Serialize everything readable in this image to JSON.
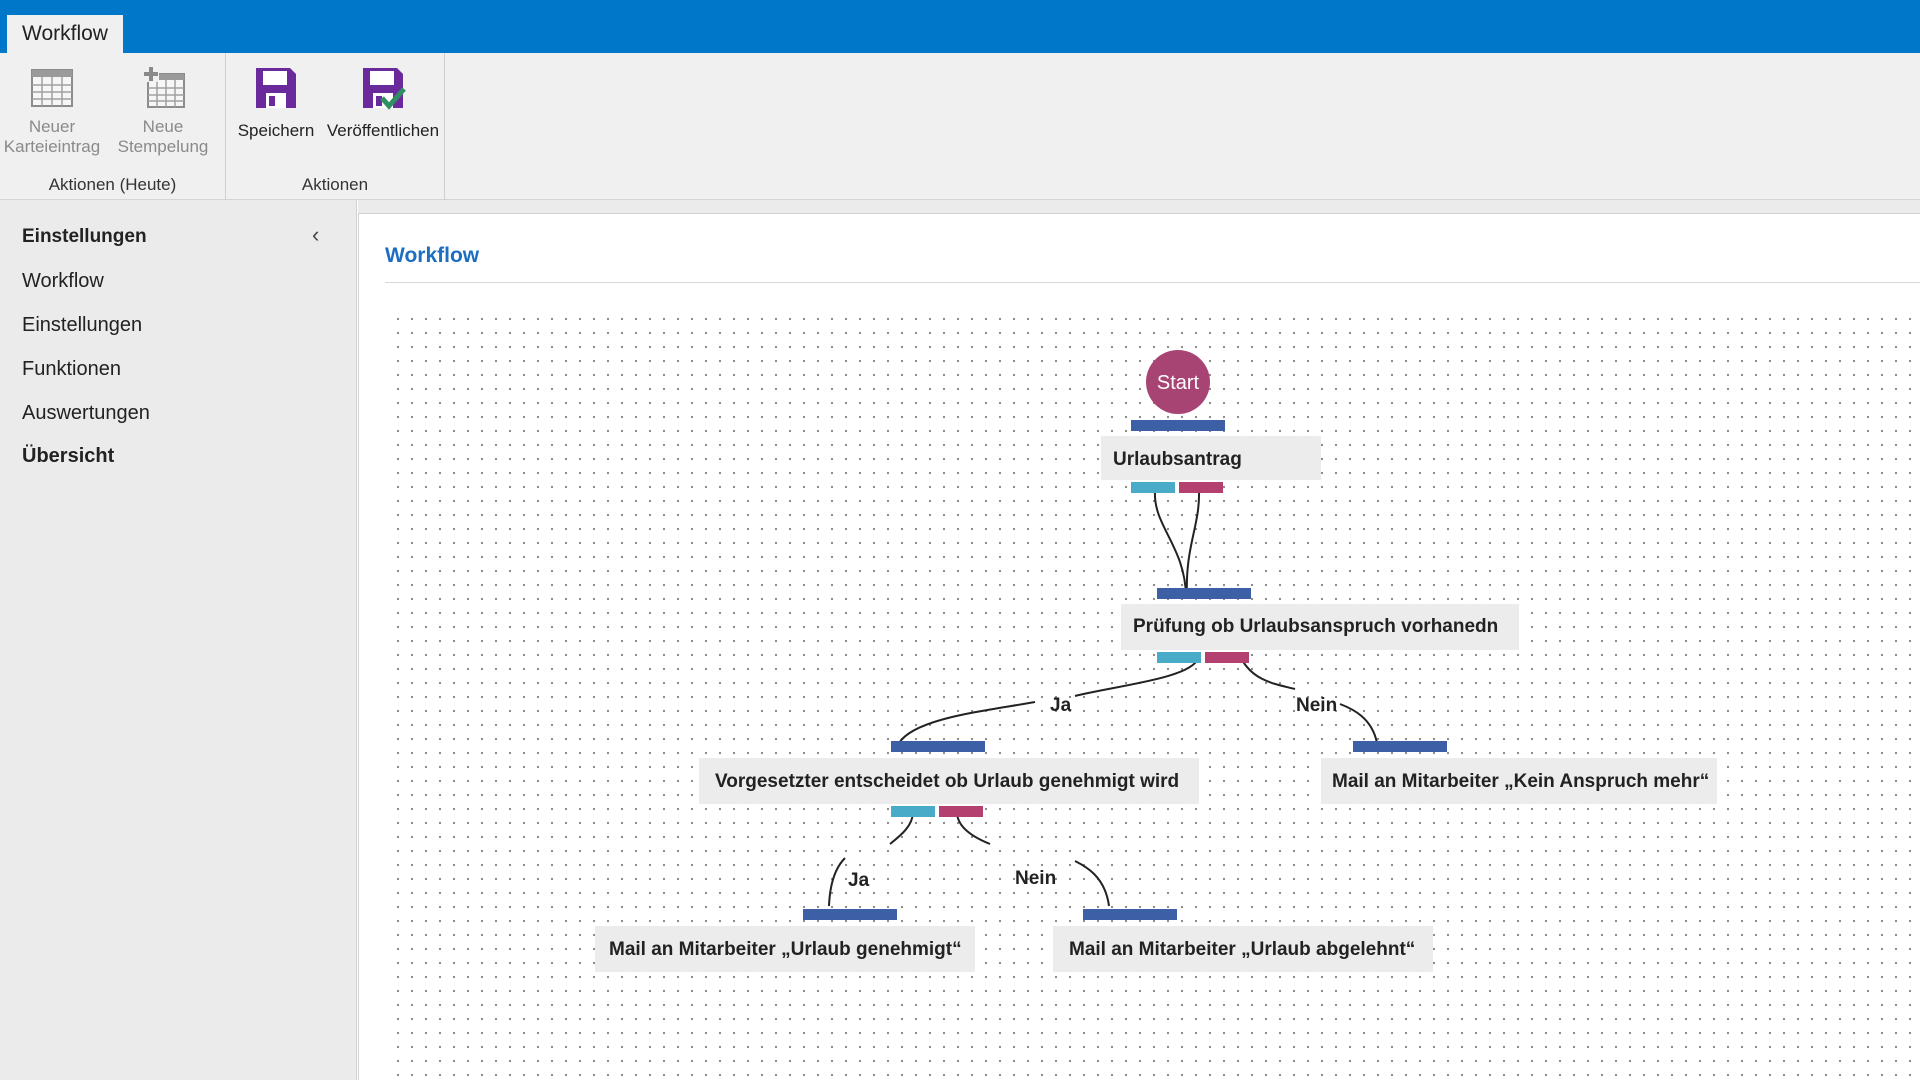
{
  "header": {
    "tab_label": "Workflow"
  },
  "ribbon": {
    "groups": [
      {
        "label": "Aktionen (Heute)",
        "buttons": [
          {
            "label_line1": "Neuer",
            "label_line2": "Karteieintrag",
            "enabled": false,
            "icon": "calendar-icon"
          },
          {
            "label_line1": "Neue",
            "label_line2": "Stempelung",
            "enabled": false,
            "icon": "calendar-add-icon"
          }
        ]
      },
      {
        "label": "Aktionen",
        "buttons": [
          {
            "label": "Speichern",
            "enabled": true,
            "icon": "save-icon"
          },
          {
            "label": "Veröffentlichen",
            "enabled": true,
            "icon": "save-publish-icon"
          }
        ]
      }
    ]
  },
  "sidebar": {
    "header": "Einstellungen",
    "items": [
      {
        "label": "Workflow",
        "bold": false
      },
      {
        "label": "Einstellungen",
        "bold": false
      },
      {
        "label": "Funktionen",
        "bold": false
      },
      {
        "label": "Auswertungen",
        "bold": false
      },
      {
        "label": "Übersicht",
        "bold": true
      }
    ]
  },
  "main": {
    "title": "Workflow"
  },
  "workflow": {
    "start_label": "Start",
    "nodes": [
      {
        "id": "urlaubsantrag",
        "label": "Urlaubsantrag"
      },
      {
        "id": "pruefung",
        "label": "Prüfung ob Urlaubsanspruch vorhanedn"
      },
      {
        "id": "vorgesetzter",
        "label": "Vorgesetzter entscheidet ob Urlaub genehmigt wird"
      },
      {
        "id": "kein-anspruch",
        "label": "Mail an Mitarbeiter „Kein Anspruch mehr“"
      },
      {
        "id": "genehmigt",
        "label": "Mail an Mitarbeiter „Urlaub genehmigt“"
      },
      {
        "id": "abgelehnt",
        "label": "Mail an Mitarbeiter „Urlaub abgelehnt“"
      }
    ],
    "edge_labels": {
      "pruefung_yes": "Ja",
      "pruefung_no": "Nein",
      "vorgesetzter_yes": "Ja",
      "vorgesetzter_no": "Nein"
    },
    "colors": {
      "start": "#a84473",
      "input_port": "#3d5fa6",
      "yes_port": "#4aabc8",
      "no_port": "#b3406f",
      "node_bg": "#ececec"
    }
  }
}
